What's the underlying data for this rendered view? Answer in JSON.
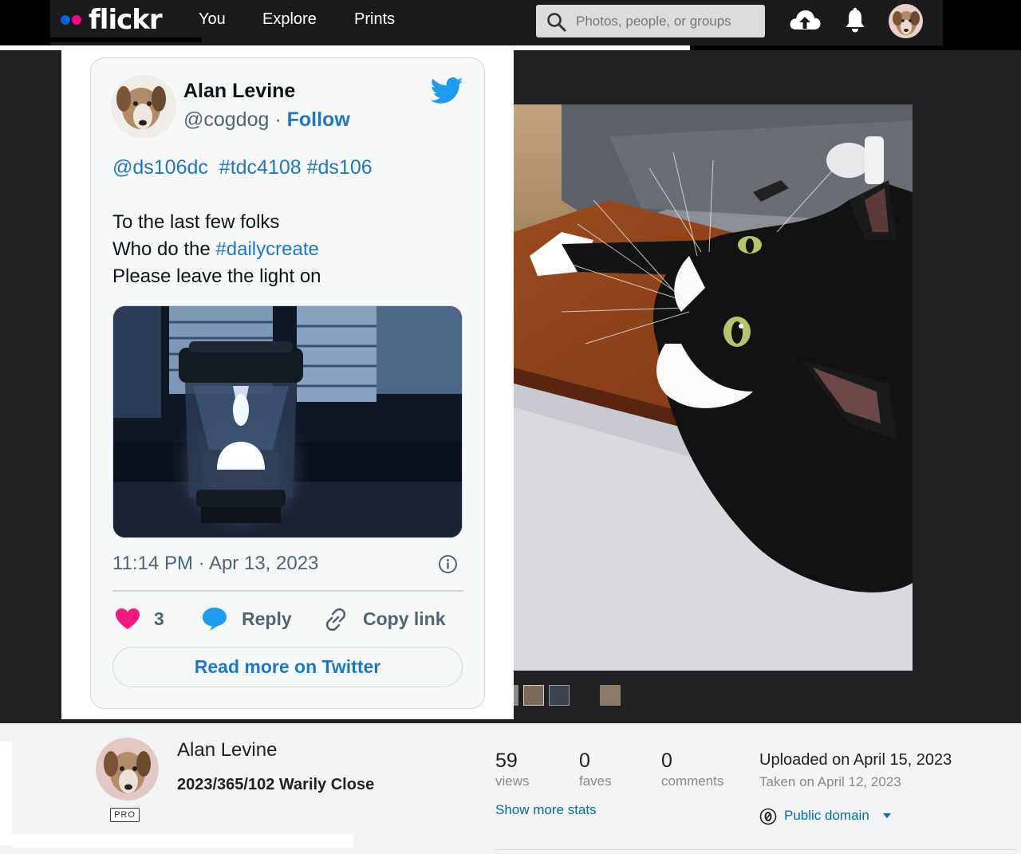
{
  "header": {
    "logo_text": "flickr",
    "nav": [
      "You",
      "Explore",
      "Prints"
    ],
    "search_placeholder": "Photos, people, or groups",
    "icons": [
      "upload-icon",
      "bell-icon",
      "avatar"
    ]
  },
  "tweet": {
    "author_name": "Alan Levine",
    "handle": "@cogdog",
    "separator": " · ",
    "follow_label": "Follow",
    "tags": "@ds106dc  #tdc4108 #ds106",
    "line1": "To the last few folks",
    "line2_prefix": "Who do the ",
    "line2_hashtag": "#dailycreate",
    "line3": "Please leave the light on",
    "timestamp": "11:14 PM · Apr 13, 2023",
    "likes": "3",
    "reply_label": "Reply",
    "copy_label": "Copy link",
    "read_more_label": "Read more on Twitter",
    "colors": {
      "link": "#1d77c8",
      "heart": "#f91880",
      "twitter": "#1d9bf0"
    }
  },
  "photo_info": {
    "owner_name": "Alan Levine",
    "title": "2023/365/102 Warily Close",
    "pro_badge": "PRO",
    "stats": {
      "views": "59",
      "views_label": "views",
      "faves": "0",
      "faves_label": "faves",
      "comments": "0",
      "comments_label": "comments"
    },
    "show_more_stats": "Show more stats",
    "uploaded": "Uploaded on April 15, 2023",
    "taken": "Taken on April 12, 2023",
    "license": "Public domain"
  },
  "colors": {
    "flickr_blue": "#0063dc",
    "flickr_pink": "#ff0084",
    "link_blue": "#006dac"
  }
}
